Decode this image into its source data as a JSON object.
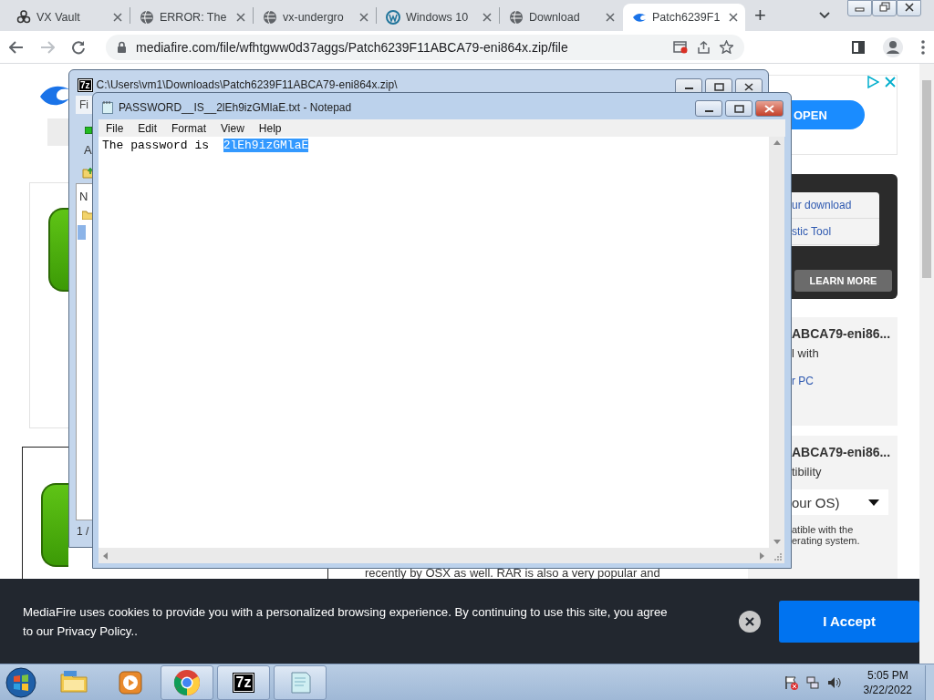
{
  "browser": {
    "tabs": [
      {
        "title": "VX Vault",
        "kind": "biohazard",
        "selected": false
      },
      {
        "title": "ERROR: The",
        "kind": "globe",
        "selected": false
      },
      {
        "title": "vx-undergro",
        "kind": "globe",
        "selected": false
      },
      {
        "title": "Windows 10",
        "kind": "wordpress",
        "selected": false
      },
      {
        "title": "Download",
        "kind": "globe",
        "selected": false
      },
      {
        "title": "Patch6239F1",
        "kind": "flame",
        "selected": true
      }
    ],
    "new_tab": "+",
    "address": "mediafire.com/file/wfhtgww0d37aggs/Patch6239F11ABCA79-eni864x.zip/file"
  },
  "page": {
    "ad": {
      "button": "OPEN"
    },
    "promo": {
      "links": [
        "ur download",
        "stic Tool"
      ],
      "button": "LEARN MORE"
    },
    "cards": [
      {
        "title": "ABCA79-eni86...",
        "lines": [
          {
            "kind": "text",
            "text": "l with"
          },
          {
            "kind": "link",
            "text": "r PC"
          }
        ]
      },
      {
        "title": "ABCA79-eni86...",
        "lines": [
          {
            "kind": "text",
            "text": "tibility"
          },
          {
            "kind": "select",
            "text": "our OS)"
          },
          {
            "kind": "note",
            "text": "atible with the"
          },
          {
            "kind": "note",
            "text": "erating system."
          }
        ]
      }
    ],
    "article_line": "recently by OSX as well. RAR is also a very popular and",
    "cookie": {
      "text": "MediaFire uses cookies to provide you with a personalized browsing experience. By continuing to use this site, you agree to our Privacy Policy..",
      "accept": "I Accept"
    }
  },
  "archive_window": {
    "logo": "7z",
    "title": "C:\\Users\\vm1\\Downloads\\Patch6239F11ABCA79-eni864x.zip\\",
    "menu": "Fi",
    "toolbar_label": "A",
    "column": "N",
    "status": "1 /"
  },
  "notepad": {
    "title": "PASSWORD__IS__2lEh9izGMlaE.txt - Notepad",
    "menu": [
      "File",
      "Edit",
      "Format",
      "View",
      "Help"
    ],
    "text": "The password is  ",
    "selected_text": "2lEh9izGMlaE"
  },
  "taskbar": {
    "apps": [
      {
        "kind": "folder",
        "running": false
      },
      {
        "kind": "media",
        "running": false
      },
      {
        "kind": "chrome",
        "running": true
      },
      {
        "kind": "archive",
        "label": "7z",
        "running": true
      },
      {
        "kind": "notepad",
        "running": true
      }
    ],
    "time": "5:05 PM",
    "date": "3/22/2022"
  }
}
